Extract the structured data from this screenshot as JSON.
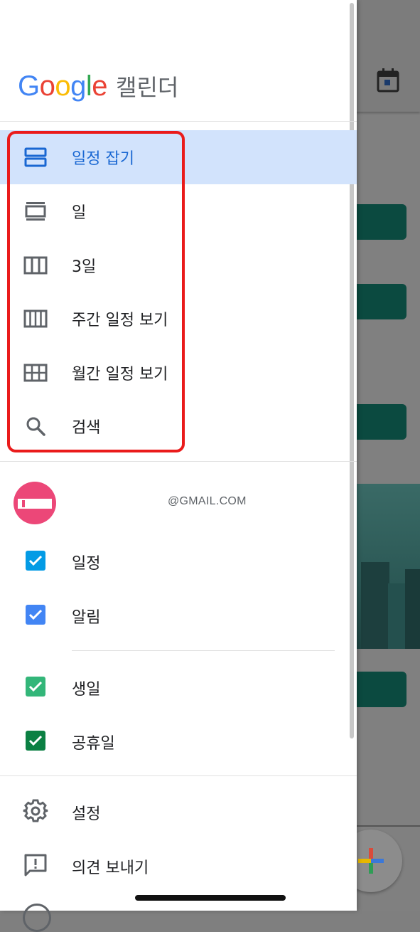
{
  "brand": {
    "logo_letters": [
      "G",
      "o",
      "o",
      "g",
      "l",
      "e"
    ],
    "logo_colors": [
      "#4285F4",
      "#EA4335",
      "#FBBC05",
      "#4285F4",
      "#34A853",
      "#EA4335"
    ],
    "name": "캘린더"
  },
  "views": [
    {
      "label": "일정 잡기",
      "icon": "schedule-view-icon",
      "active": true
    },
    {
      "label": "일",
      "icon": "day-view-icon",
      "active": false
    },
    {
      "label": "3일",
      "icon": "three-day-view-icon",
      "active": false
    },
    {
      "label": "주간 일정 보기",
      "icon": "week-view-icon",
      "active": false
    },
    {
      "label": "월간 일정 보기",
      "icon": "month-view-icon",
      "active": false
    },
    {
      "label": "검색",
      "icon": "search-icon",
      "active": false
    }
  ],
  "account": {
    "email": "@GMAIL.COM",
    "avatar_color": "#EC4778"
  },
  "calendars": [
    {
      "label": "일정",
      "color": "#039BE5",
      "checked": true
    },
    {
      "label": "알림",
      "color": "#4285F4",
      "checked": true
    }
  ],
  "other_calendars": [
    {
      "label": "생일",
      "color": "#33B679",
      "checked": true
    },
    {
      "label": "공휴일",
      "color": "#0B8043",
      "checked": true
    }
  ],
  "footer": [
    {
      "label": "설정",
      "icon": "gear-icon"
    },
    {
      "label": "의견 보내기",
      "icon": "feedback-icon"
    }
  ],
  "colors": {
    "active_bg": "#D2E3FC",
    "active_text": "#1967D2",
    "annotation_box": "#EA1B1B"
  }
}
